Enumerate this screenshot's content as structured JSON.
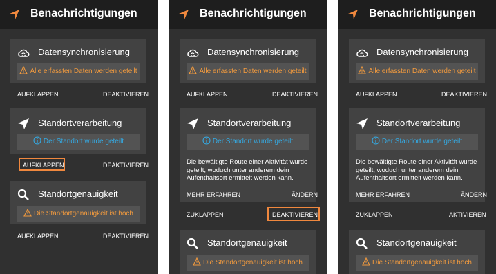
{
  "header": {
    "title": "Benachrichtigungen"
  },
  "sync": {
    "title": "Datensynchronisierung",
    "alert": "Alle erfassten Daten werden geteilt",
    "expand_label": "AUFKLAPPEN",
    "disable_label": "DEAKTIVIEREN"
  },
  "location": {
    "title": "Standortverarbeitung",
    "alert": "Der Standort wurde geteilt",
    "expand_label": "AUFKLAPPEN",
    "collapse_label": "ZUKLAPPEN",
    "disable_label": "DEAKTIVIEREN",
    "description": "Die bewältigte Route einer Aktivität wurde geteilt, woduch unter anderem dein Aufenthaltsort ermittelt werden kann.",
    "learn_more_label": "MEHR ERFAHREN",
    "change_label": "ÄNDERN",
    "disabled_label": "AKTIVIEREN"
  },
  "accuracy": {
    "title": "Standortgenauigkeit",
    "alert": "Die Standortgenauigkeit ist hoch",
    "expand_label": "AUFKLAPPEN",
    "disable_label": "DEAKTIVIEREN"
  },
  "colors": {
    "background": "#303030",
    "card": "#424242",
    "top_bar": "#1e1e1e",
    "accent_orange": "#f0883e",
    "warning_text": "#f19a3e",
    "info_text": "#35a8e0"
  },
  "icons": [
    "navigation-arrow-icon",
    "cloud-sync-icon",
    "warning-icon",
    "location-arrow-icon",
    "info-icon",
    "search-icon"
  ]
}
